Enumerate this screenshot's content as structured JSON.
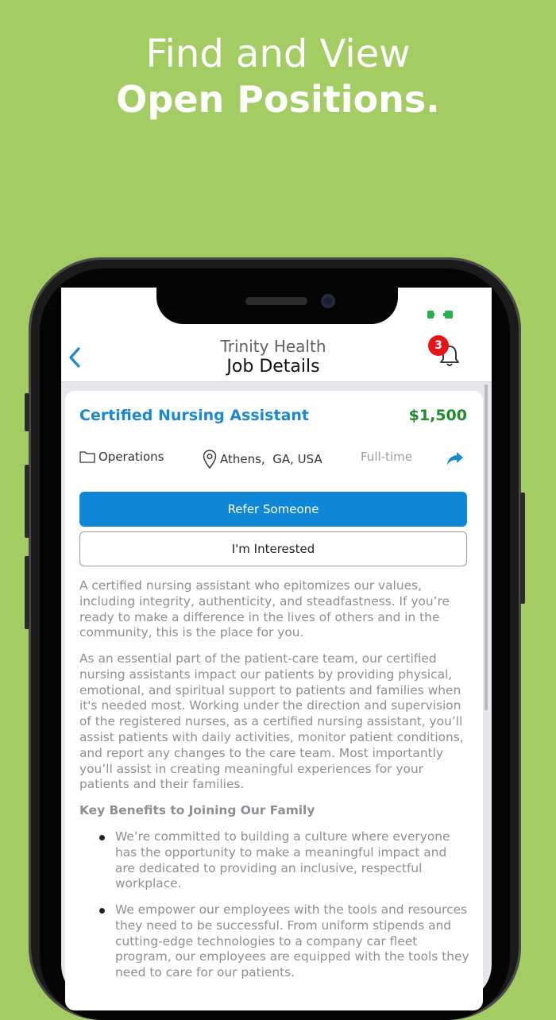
{
  "headline": {
    "line1": "Find and View",
    "line2": "Open Positions."
  },
  "header": {
    "organization": "Trinity Health",
    "title": "Job Details",
    "notification_count": "3"
  },
  "job": {
    "title": "Certified Nursing Assistant",
    "salary": "$1,500",
    "department": "Operations",
    "location": "Athens,  GA, USA",
    "employment_type": "Full-time"
  },
  "actions": {
    "refer_label": "Refer Someone",
    "interested_label": "I'm Interested"
  },
  "description": {
    "paragraph1": "A certified nursing assistant who epitomizes our values, including integrity, authenticity, and steadfastness. If you’re ready to make a difference in the lives of others and in the community, this is the place for you.",
    "paragraph2": "As an essential part of the patient-care team, our certified nursing assistants impact our patients by providing physical, emotional, and spiritual support to patients and families when it's needed most. Working under the direction and supervision of the registered nurses, as a certified nursing assistant,  you’ll assist patients with daily activities, monitor patient conditions, and report any changes to the care team. Most importantly you’ll assist in creating meaningful experiences for your patients and their families.",
    "benefits_heading": "Key Benefits to Joining Our Family",
    "benefits": [
      "We’re committed to building a culture where everyone has the opportunity to make a meaningful impact and are dedicated to providing an inclusive, respectful workplace.",
      "We empower our employees with the tools and resources they need to be successful. From uniform stipends and cutting-edge technologies to a company car fleet program, our employees are equipped with the tools they need to care for our patients."
    ]
  },
  "colors": {
    "background": "#a3cd62",
    "primary": "#0f86d6",
    "title": "#1c88cd",
    "salary": "#1f8b2d",
    "badge": "#e8141c"
  },
  "icons": [
    "chevron-left-icon",
    "bell-icon",
    "folder-icon",
    "location-pin-icon",
    "share-icon",
    "battery-icon"
  ]
}
